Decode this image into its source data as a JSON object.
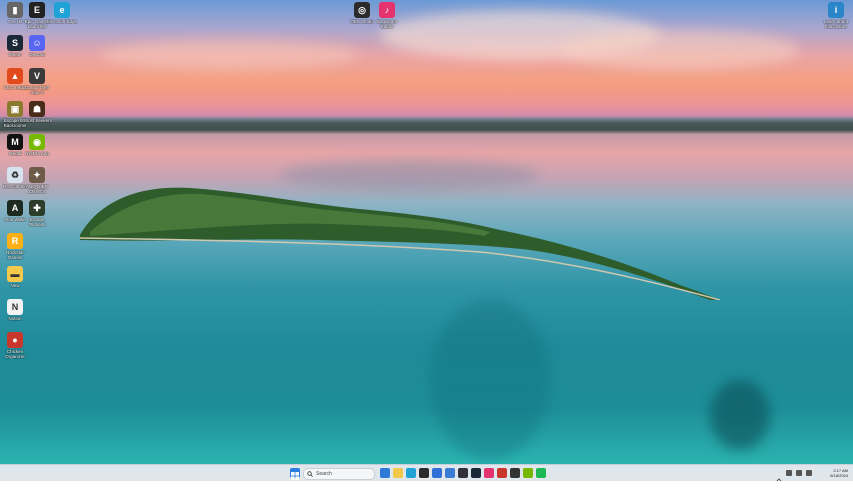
{
  "desktop": {
    "icons_left": [
      {
        "label": "The Hit",
        "color": "#666666",
        "glyph": "▮"
      },
      {
        "label": "Epic Games Launcher",
        "color": "#222222",
        "glyph": "E"
      },
      {
        "label": "Microsoft Edge",
        "color": "#1fa2d6",
        "glyph": "e"
      },
      {
        "label": "Steam",
        "color": "#1b2838",
        "glyph": "S"
      },
      {
        "label": "Discord",
        "color": "#5865f2",
        "glyph": "☺"
      },
      {
        "label": "VLC media",
        "color": "#e2491d",
        "glyph": "▲"
      },
      {
        "label": "Grand Theft Auto V",
        "color": "#3b3b3b",
        "glyph": "V"
      },
      {
        "label": "Escape the Backrooms",
        "color": "#8a7a2e",
        "glyph": "▣"
      },
      {
        "label": "Ghost Seekers",
        "color": "#4a2c1a",
        "glyph": "☗"
      },
      {
        "label": "Medal",
        "color": "#111111",
        "glyph": "M"
      },
      {
        "label": "NVIDIA App",
        "color": "#76b900",
        "glyph": "◉"
      },
      {
        "label": "Recycle Bin",
        "color": "#d7e3ee",
        "glyph": "♻"
      },
      {
        "label": "ANOTHER CRAB'S TREASURE",
        "color": "#6d5a48",
        "glyph": "✦"
      },
      {
        "label": "Alan Wake",
        "color": "#1d2a1f",
        "glyph": "A"
      },
      {
        "label": "Escape Tsunami",
        "color": "#2c3d2a",
        "glyph": "✚"
      },
      {
        "label": "Rockstar Games Launcher",
        "color": "#fcaf17",
        "glyph": "R"
      },
      {
        "label": "New",
        "color": "#f3c84b",
        "glyph": "▬"
      },
      {
        "label": "Notion",
        "color": "#f2f2f2",
        "glyph": "N"
      },
      {
        "label": "Chicken Organizer",
        "color": "#c9372c",
        "glyph": "●"
      }
    ],
    "icons_top_center": [
      {
        "label": "OBS Studio",
        "color": "#2b2b2b",
        "glyph": "◎"
      },
      {
        "label": "Bandicam Studio",
        "color": "#e5336f",
        "glyph": "♪"
      }
    ],
    "icons_top_right": [
      {
        "label": "Learn about this picture",
        "color": "#2a86c8",
        "glyph": "i"
      }
    ]
  },
  "taskbar": {
    "start_icon": "windows-logo",
    "search_placeholder": "Search",
    "pinned": [
      {
        "name": "chrome-icon",
        "color": "#2d7bd6"
      },
      {
        "name": "file-explorer-icon",
        "color": "#f2c84b"
      },
      {
        "name": "edge-icon",
        "color": "#1fa2d6"
      },
      {
        "name": "terminal-icon",
        "color": "#2b2b2b"
      },
      {
        "name": "store-icon",
        "color": "#2f6fd6"
      },
      {
        "name": "photos-icon",
        "color": "#3a7bd5"
      },
      {
        "name": "obs-icon",
        "color": "#302f3a"
      },
      {
        "name": "steam-icon",
        "color": "#1b2838"
      },
      {
        "name": "bandicam-icon",
        "color": "#e5336f"
      },
      {
        "name": "chicken-icon",
        "color": "#c9372c"
      },
      {
        "name": "app-icon",
        "color": "#333333"
      },
      {
        "name": "nvidia-icon",
        "color": "#76b900"
      },
      {
        "name": "spotify-icon",
        "color": "#1db954"
      }
    ],
    "tray": {
      "time": "2:17 AM",
      "date": "6/18/2024"
    }
  }
}
